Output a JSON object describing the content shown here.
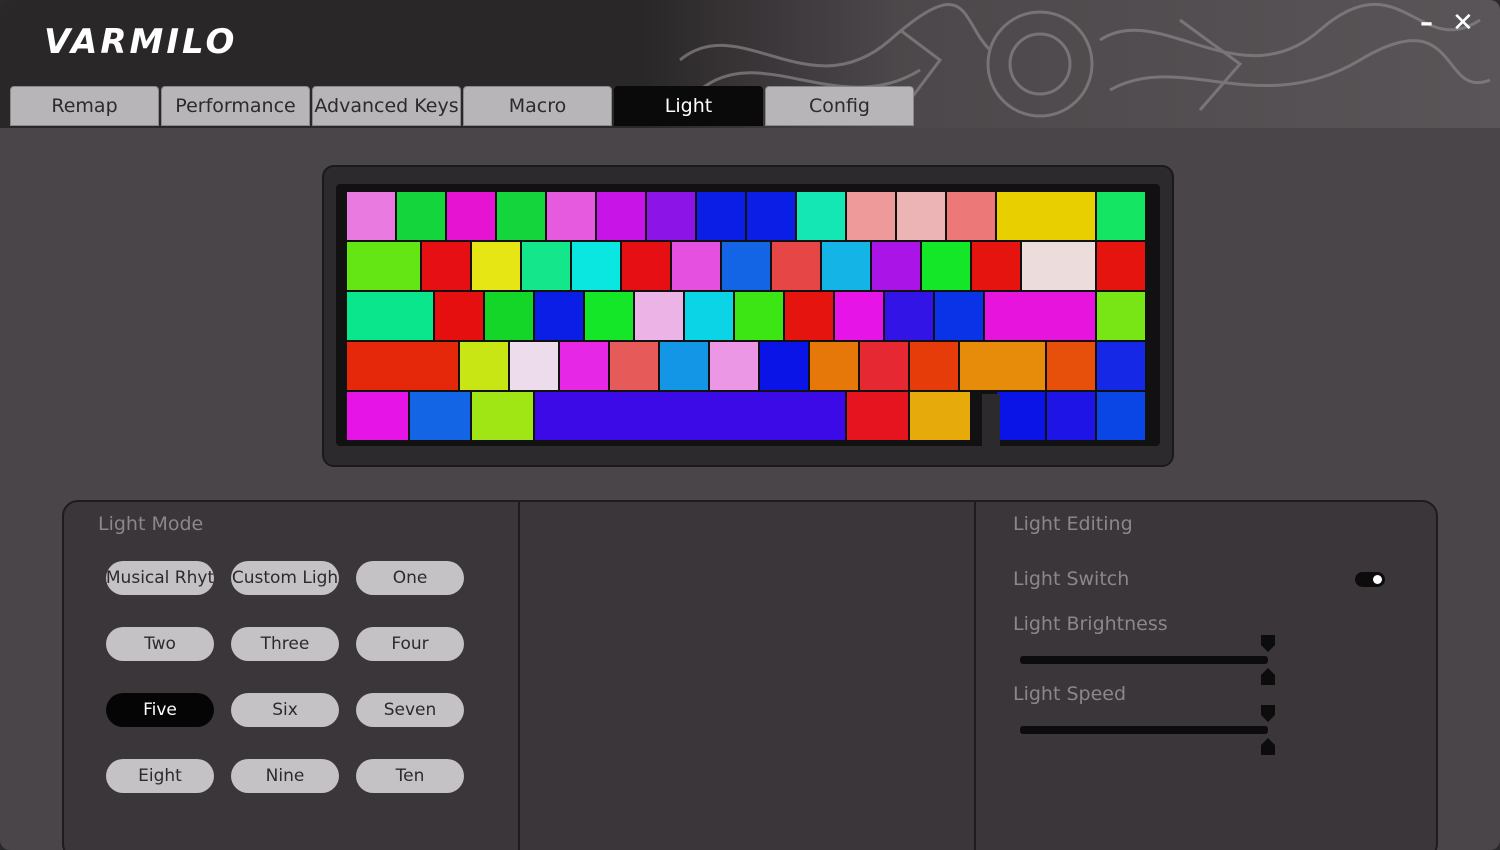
{
  "app": {
    "logo": "VARMILO",
    "minimize": "–",
    "close": "✕"
  },
  "tabs": [
    {
      "label": "Remap",
      "active": false
    },
    {
      "label": "Performance",
      "active": false
    },
    {
      "label": "Advanced Keys",
      "active": false
    },
    {
      "label": "Macro",
      "active": false
    },
    {
      "label": "Light",
      "active": true
    },
    {
      "label": "Config",
      "active": false
    }
  ],
  "keyboard": {
    "rows": [
      [
        {
          "u": 1,
          "c": "#e87ae0"
        },
        {
          "u": 1,
          "c": "#14d63c"
        },
        {
          "u": 1,
          "c": "#e614d2"
        },
        {
          "u": 1,
          "c": "#14d63c"
        },
        {
          "u": 1,
          "c": "#e65ae0"
        },
        {
          "u": 1,
          "c": "#c814e6"
        },
        {
          "u": 1,
          "c": "#8c14e6"
        },
        {
          "u": 1,
          "c": "#0a1ee6"
        },
        {
          "u": 1,
          "c": "#0a1ee6"
        },
        {
          "u": 1,
          "c": "#14e6b4"
        },
        {
          "u": 1,
          "c": "#ee9a9a"
        },
        {
          "u": 1,
          "c": "#ecb4b4"
        },
        {
          "u": 1,
          "c": "#ec7878"
        },
        {
          "u": 2,
          "c": "#e8d000"
        },
        {
          "u": 1,
          "c": "#14e664"
        }
      ],
      [
        {
          "u": 1.5,
          "c": "#64e614"
        },
        {
          "u": 1,
          "c": "#e60f14"
        },
        {
          "u": 1,
          "c": "#e6e614"
        },
        {
          "u": 1,
          "c": "#14e68c"
        },
        {
          "u": 1,
          "c": "#0ae6e0"
        },
        {
          "u": 1,
          "c": "#e60f14"
        },
        {
          "u": 1,
          "c": "#e650e0"
        },
        {
          "u": 1,
          "c": "#1464e6"
        },
        {
          "u": 1,
          "c": "#e64646"
        },
        {
          "u": 1,
          "c": "#14b4e6"
        },
        {
          "u": 1,
          "c": "#aa14e6"
        },
        {
          "u": 1,
          "c": "#14e628"
        },
        {
          "u": 1,
          "c": "#e6140f"
        },
        {
          "u": 1.5,
          "c": "#ecdcdc"
        },
        {
          "u": 1,
          "c": "#e6140f"
        }
      ],
      [
        {
          "u": 1.75,
          "c": "#0ae68c"
        },
        {
          "u": 1,
          "c": "#e60f0f"
        },
        {
          "u": 1,
          "c": "#14d628"
        },
        {
          "u": 1,
          "c": "#0a1ee6"
        },
        {
          "u": 1,
          "c": "#14e628"
        },
        {
          "u": 1,
          "c": "#ecb4e6"
        },
        {
          "u": 1,
          "c": "#0ad4e6"
        },
        {
          "u": 1,
          "c": "#3ce614"
        },
        {
          "u": 1,
          "c": "#e6140f"
        },
        {
          "u": 1,
          "c": "#e614e6"
        },
        {
          "u": 1,
          "c": "#3214e6"
        },
        {
          "u": 1,
          "c": "#0a32e6"
        },
        {
          "u": 2.25,
          "c": "#e614dc"
        },
        {
          "u": 1,
          "c": "#78e614"
        }
      ],
      [
        {
          "u": 2.25,
          "c": "#e6280a"
        },
        {
          "u": 1,
          "c": "#c8e614"
        },
        {
          "u": 1,
          "c": "#ecdcec"
        },
        {
          "u": 1,
          "c": "#e628e6"
        },
        {
          "u": 1,
          "c": "#e65a5a"
        },
        {
          "u": 1,
          "c": "#1496e6"
        },
        {
          "u": 1,
          "c": "#ec96e6"
        },
        {
          "u": 1,
          "c": "#0a14e6"
        },
        {
          "u": 1,
          "c": "#e6780a"
        },
        {
          "u": 1,
          "c": "#e62832"
        },
        {
          "u": 1,
          "c": "#e63c0a"
        },
        {
          "u": 1.75,
          "c": "#e68c0a"
        },
        {
          "u": 1,
          "c": "#e6500a"
        },
        {
          "u": 1,
          "c": "#1428e6"
        }
      ],
      [
        {
          "u": 1.25,
          "c": "#e614e6"
        },
        {
          "u": 1.25,
          "c": "#1464e6"
        },
        {
          "u": 1.25,
          "c": "#a0e614"
        },
        {
          "u": 6.25,
          "c": "#3c0ae6"
        },
        {
          "u": 1.25,
          "c": "#e6141e"
        },
        {
          "u": 1.25,
          "c": "#e6aa0a"
        },
        {
          "gap": 0.5
        },
        {
          "u": 1,
          "c": "#0a14e6"
        },
        {
          "u": 1,
          "c": "#1e14e6"
        },
        {
          "u": 1,
          "c": "#0a46e6"
        }
      ]
    ]
  },
  "light_mode": {
    "title": "Light Mode",
    "buttons": [
      {
        "label": "Musical Rhyt",
        "active": false
      },
      {
        "label": "Custom Ligh",
        "active": false
      },
      {
        "label": "One",
        "active": false
      },
      {
        "label": "Two",
        "active": false
      },
      {
        "label": "Three",
        "active": false
      },
      {
        "label": "Four",
        "active": false
      },
      {
        "label": "Five",
        "active": true
      },
      {
        "label": "Six",
        "active": false
      },
      {
        "label": "Seven",
        "active": false
      },
      {
        "label": "Eight",
        "active": false
      },
      {
        "label": "Nine",
        "active": false
      },
      {
        "label": "Ten",
        "active": false
      }
    ]
  },
  "light_editing": {
    "title": "Light Editing",
    "switch_label": "Light Switch",
    "switch_on": true,
    "brightness_label": "Light Brightness",
    "brightness_value": 1.0,
    "speed_label": "Light Speed",
    "speed_value": 1.0
  },
  "colors": {
    "accent_active": "#050505",
    "tab_inactive": "#b7b5b7",
    "panel_bg": "#3a3639"
  }
}
